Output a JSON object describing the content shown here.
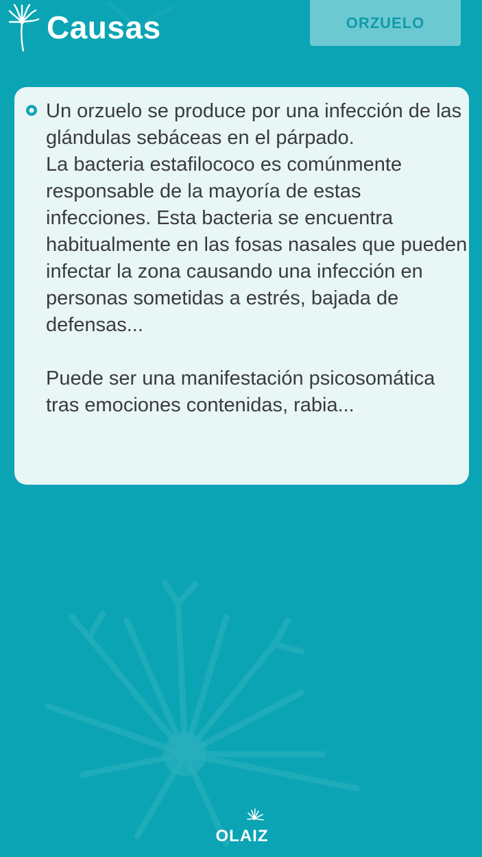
{
  "header": {
    "title": "Causas",
    "tag_label": "ORZUELO",
    "app_icon": "dandelion-icon"
  },
  "card": {
    "bullet_icon": "circle-bullet-icon",
    "paragraph": "Un orzuelo se produce por una infección de las glándulas sebáceas en el párpado.\nLa bacteria estafilococo es comúnmente responsable de la mayoría de estas infecciones. Esta bacteria se encuentra habitualmente en las fosas nasales que pueden infectar la zona causando una infección en personas sometidas a estrés, bajada de defensas...\n\nPuede ser una manifestación psicosomática tras emociones contenidas, rabia..."
  },
  "footer": {
    "logo_text": "OLAIZ"
  },
  "colors": {
    "background": "#0ba4b4",
    "card": "#e8f6f6",
    "tag_background": "#6dc9d1",
    "tag_text": "#109aaa"
  }
}
